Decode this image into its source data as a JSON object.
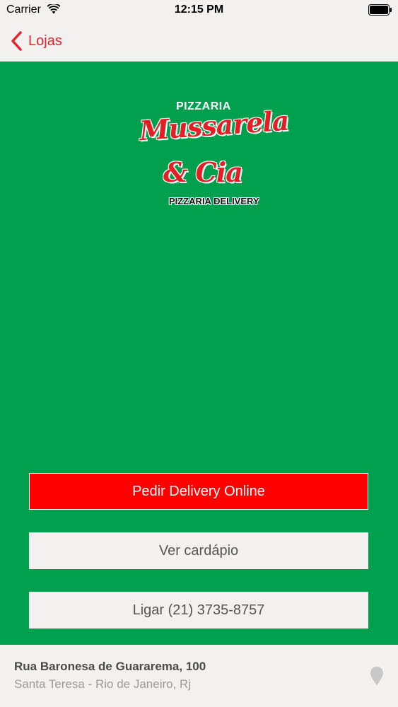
{
  "status_bar": {
    "carrier": "Carrier",
    "time": "12:15 PM",
    "wifi_icon": "wifi-icon",
    "battery_icon": "battery-icon"
  },
  "nav": {
    "back_label": "Lojas",
    "back_icon": "chevron-left-icon"
  },
  "logo": {
    "top_text": "PIZZARIA",
    "name": "Mussarela",
    "amp": "& Cia",
    "subtitle": "PIZZARIA DELIVERY"
  },
  "actions": {
    "delivery_label": "Pedir Delivery Online",
    "menu_label": "Ver cardápio",
    "call_label": "Ligar (21) 3735-8757"
  },
  "address": {
    "street": "Rua Baronesa de Guararema, 100",
    "city": "Santa Teresa - Rio de Janeiro, Rj",
    "map_icon": "map-pin-icon"
  },
  "colors": {
    "brand_green": "#00a04f",
    "accent_red": "#ff0000",
    "nav_tint": "#e5222a",
    "bar_background": "#f2f1ef"
  }
}
